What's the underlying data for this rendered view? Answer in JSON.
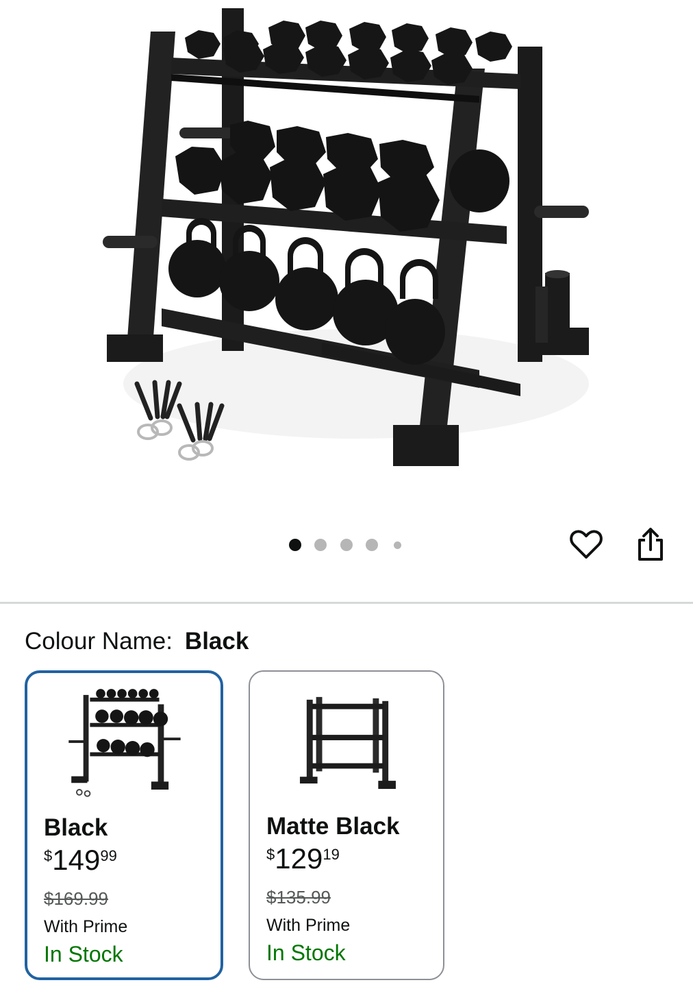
{
  "product_image": {
    "icon": "weight-rack-image"
  },
  "carousel": {
    "total": 5,
    "active": 0
  },
  "actions": {
    "wishlist_icon": "heart-icon",
    "share_icon": "share-icon"
  },
  "colour": {
    "label": "Colour Name:",
    "value": "Black"
  },
  "variants": [
    {
      "name": "Black",
      "currency": "$",
      "price_whole": "149",
      "price_fraction": "99",
      "list_price": "$169.99",
      "prime": "With Prime",
      "stock": "In Stock",
      "selected": true
    },
    {
      "name": "Matte Black",
      "currency": "$",
      "price_whole": "129",
      "price_fraction": "19",
      "list_price": "$135.99",
      "prime": "With Prime",
      "stock": "In Stock",
      "selected": false
    }
  ],
  "colors": {
    "accent": "#2162a1",
    "stock": "#007600",
    "frame": "#1a1a1a"
  }
}
